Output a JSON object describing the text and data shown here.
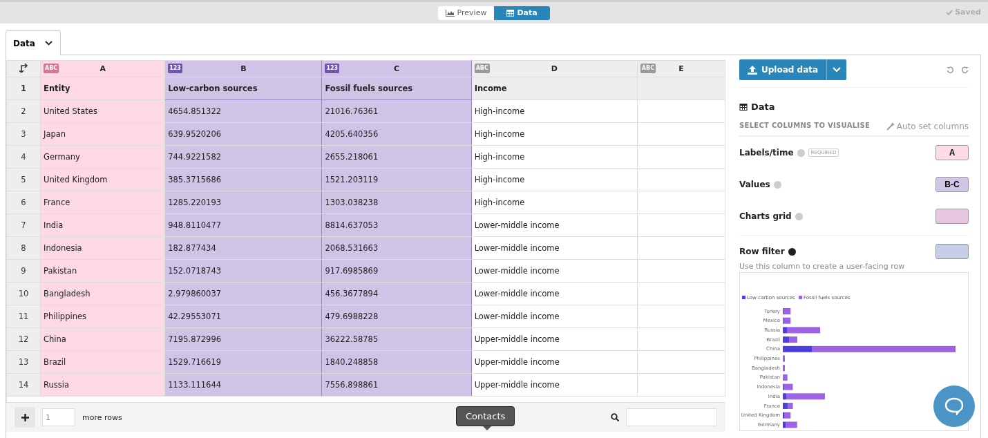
{
  "topbar": {
    "views": [
      {
        "label": "Preview",
        "kind": "preview",
        "selected": false
      },
      {
        "label": "Data",
        "kind": "data",
        "selected": true
      }
    ],
    "status": "Saved"
  },
  "sheet_tab": {
    "label": "Data"
  },
  "table": {
    "columns": [
      {
        "letter": "A",
        "type": "ABC",
        "color": "#fdd9e3"
      },
      {
        "letter": "B",
        "type": "123",
        "color": "#d0c4e6"
      },
      {
        "letter": "C",
        "type": "123",
        "color": "#d0c4e6"
      },
      {
        "letter": "D",
        "type": "ABC"
      },
      {
        "letter": "E",
        "type": "ABC"
      }
    ],
    "rows": [
      {
        "number": "1",
        "cells": [
          "Entity",
          "Low-carbon sources",
          "Fossil fuels sources",
          "Income",
          ""
        ]
      },
      {
        "number": "2",
        "cells": [
          "United States",
          "4654.851322",
          "21016.76361",
          "High-income",
          ""
        ]
      },
      {
        "number": "3",
        "cells": [
          "Japan",
          "639.9520206",
          "4205.640356",
          "High-income",
          ""
        ]
      },
      {
        "number": "4",
        "cells": [
          "Germany",
          "744.9221582",
          "2655.218061",
          "High-income",
          ""
        ]
      },
      {
        "number": "5",
        "cells": [
          "United Kingdom",
          "385.3715686",
          "1521.203119",
          "High-income",
          ""
        ]
      },
      {
        "number": "6",
        "cells": [
          "France",
          "1285.220193",
          "1303.038238",
          "High-income",
          ""
        ]
      },
      {
        "number": "7",
        "cells": [
          "India",
          "948.8110477",
          "8814.637053",
          "Lower-middle income",
          ""
        ]
      },
      {
        "number": "8",
        "cells": [
          "Indonesia",
          "182.877434",
          "2068.531663",
          "Lower-middle income",
          ""
        ]
      },
      {
        "number": "9",
        "cells": [
          "Pakistan",
          "152.0718743",
          "917.6985869",
          "Lower-middle income",
          ""
        ]
      },
      {
        "number": "10",
        "cells": [
          "Bangladesh",
          "2.979860037",
          "456.3677894",
          "Lower-middle income",
          ""
        ]
      },
      {
        "number": "11",
        "cells": [
          "Philippines",
          "42.29553071",
          "479.6988228",
          "Lower-middle income",
          ""
        ]
      },
      {
        "number": "12",
        "cells": [
          "China",
          "7195.872996",
          "36222.58785",
          "Upper-middle income",
          ""
        ]
      },
      {
        "number": "13",
        "cells": [
          "Brazil",
          "1529.716619",
          "1840.248858",
          "Upper-middle income",
          ""
        ]
      },
      {
        "number": "14",
        "cells": [
          "Russia",
          "1133.111644",
          "7556.898861",
          "Upper-middle income",
          ""
        ]
      }
    ]
  },
  "footer": {
    "add_rows_value": "1",
    "add_rows_label": "more rows"
  },
  "tooltip": "Contacts",
  "panel": {
    "upload_label": "Upload data",
    "section_title": "Data",
    "select_heading": "SELECT COLUMNS TO VISUALISE",
    "auto_link": "Auto set columns",
    "bindings": [
      {
        "label": "Labels/time",
        "badge": "REQUIRED",
        "value": "A",
        "color": "#fddce5",
        "help_dark": false
      },
      {
        "label": "Values",
        "value": "B-C",
        "color": "#d2c6e8",
        "help_dark": false
      },
      {
        "label": "Charts grid",
        "color": "#e7c6e0",
        "help_dark": false
      },
      {
        "label": "Row filter",
        "color": "#c6cde6",
        "help_dark": true,
        "note": "Use this column to create a user-facing row"
      }
    ],
    "preview": {
      "legend": [
        "Low-carbon sources",
        "Fossil fuels sources"
      ],
      "labels": [
        "Turkey",
        "Mexico",
        "Russia",
        "Brazil",
        "China",
        "Philippines",
        "Bangladesh",
        "Pakistan",
        "Indonesia",
        "India",
        "France",
        "United Kingdom",
        "Germany"
      ]
    }
  }
}
